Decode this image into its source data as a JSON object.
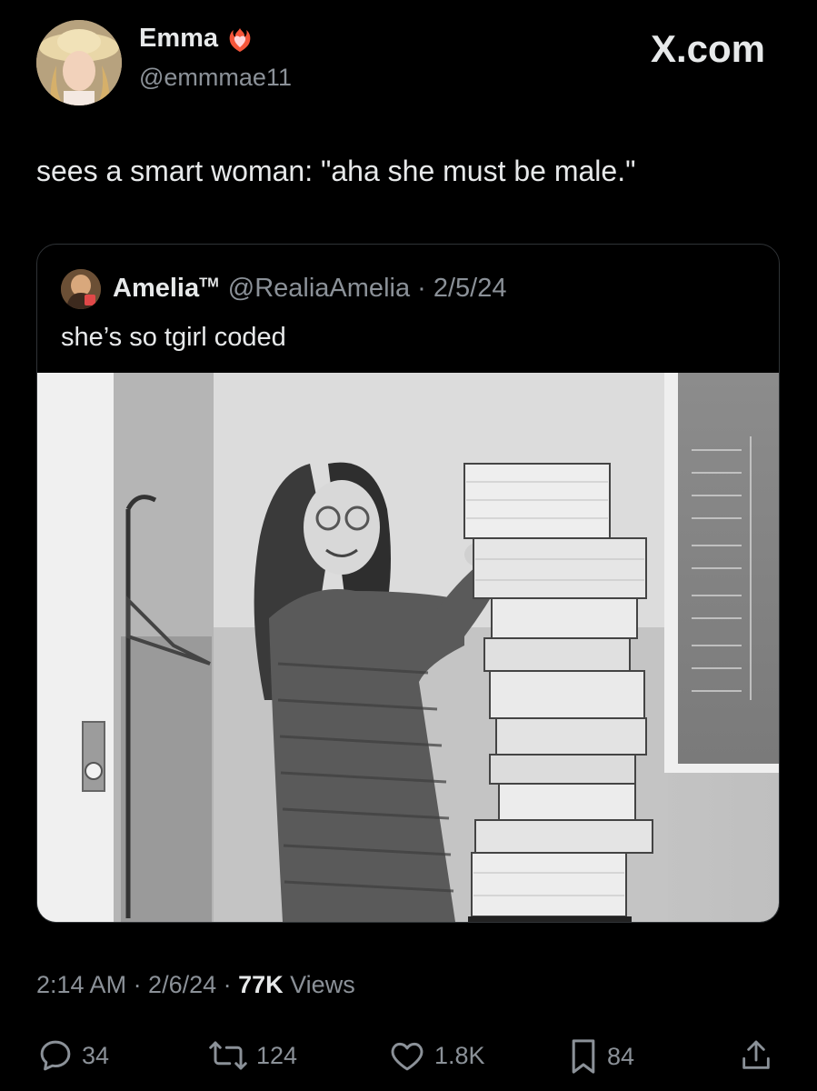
{
  "author": {
    "name": "Emma",
    "handle": "@emmmae11",
    "badge_icon": "heart-on-fire-icon"
  },
  "brand": "X.com",
  "tweet": {
    "text": "sees a smart woman: \"aha she must be male.\""
  },
  "quote": {
    "name": "Amelia",
    "name_suffix": "TM",
    "meta": "@RealiaAmelia · 2/5/24",
    "text": "she’s so tgirl coded",
    "image_caption": "Black-and-white photo of a smiling woman with long hair and glasses standing next to a tall stack of printed code listings"
  },
  "meta": {
    "time_date": "2:14 AM · 2/6/24 · ",
    "views_count": "77K",
    "views_label": " Views"
  },
  "actions": {
    "replies": "34",
    "reposts": "124",
    "likes": "1.8K",
    "bookmarks": "84"
  },
  "colors": {
    "background": "#000000",
    "text": "#e7e9ea",
    "secondary": "#8b9198",
    "border": "#2f3336",
    "badge": "#f91880"
  }
}
